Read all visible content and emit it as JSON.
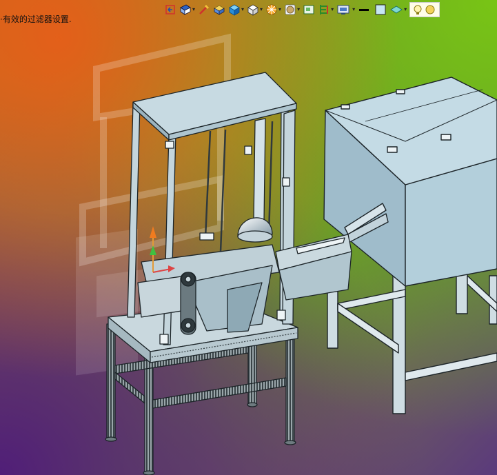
{
  "status_message": "·有效的过滤器设置.",
  "toolbar": {
    "items": [
      {
        "name": "previous-view-icon",
        "has_dropdown": false
      },
      {
        "name": "view-orientation-icon",
        "has_dropdown": true
      },
      {
        "name": "section-view-icon",
        "has_dropdown": false
      },
      {
        "name": "dynamic-annotation-icon",
        "has_dropdown": false
      },
      {
        "name": "display-style-icon",
        "has_dropdown": true
      },
      {
        "name": "hide-show-items-icon",
        "has_dropdown": true
      },
      {
        "name": "edit-appearance-icon",
        "has_dropdown": true
      },
      {
        "name": "apply-scene-icon",
        "has_dropdown": true
      },
      {
        "name": "view-settings-icon",
        "has_dropdown": false
      },
      {
        "name": "toggle-display-icon",
        "has_dropdown": true
      },
      {
        "name": "display-manager-icon",
        "has_dropdown": true
      },
      {
        "name": "line-color-icon",
        "has_dropdown": false
      },
      {
        "name": "edge-color-icon",
        "has_dropdown": false
      },
      {
        "name": "shaded-plane-icon",
        "has_dropdown": true
      },
      {
        "name": "lighting-icon",
        "has_dropdown": false
      }
    ]
  },
  "colors": {
    "steel": "#aecbd8",
    "steel_dark": "#7d9aaa",
    "frame_line": "#1c2428",
    "extrusion": "#c7d2d6",
    "ghost": "#ffffff"
  }
}
